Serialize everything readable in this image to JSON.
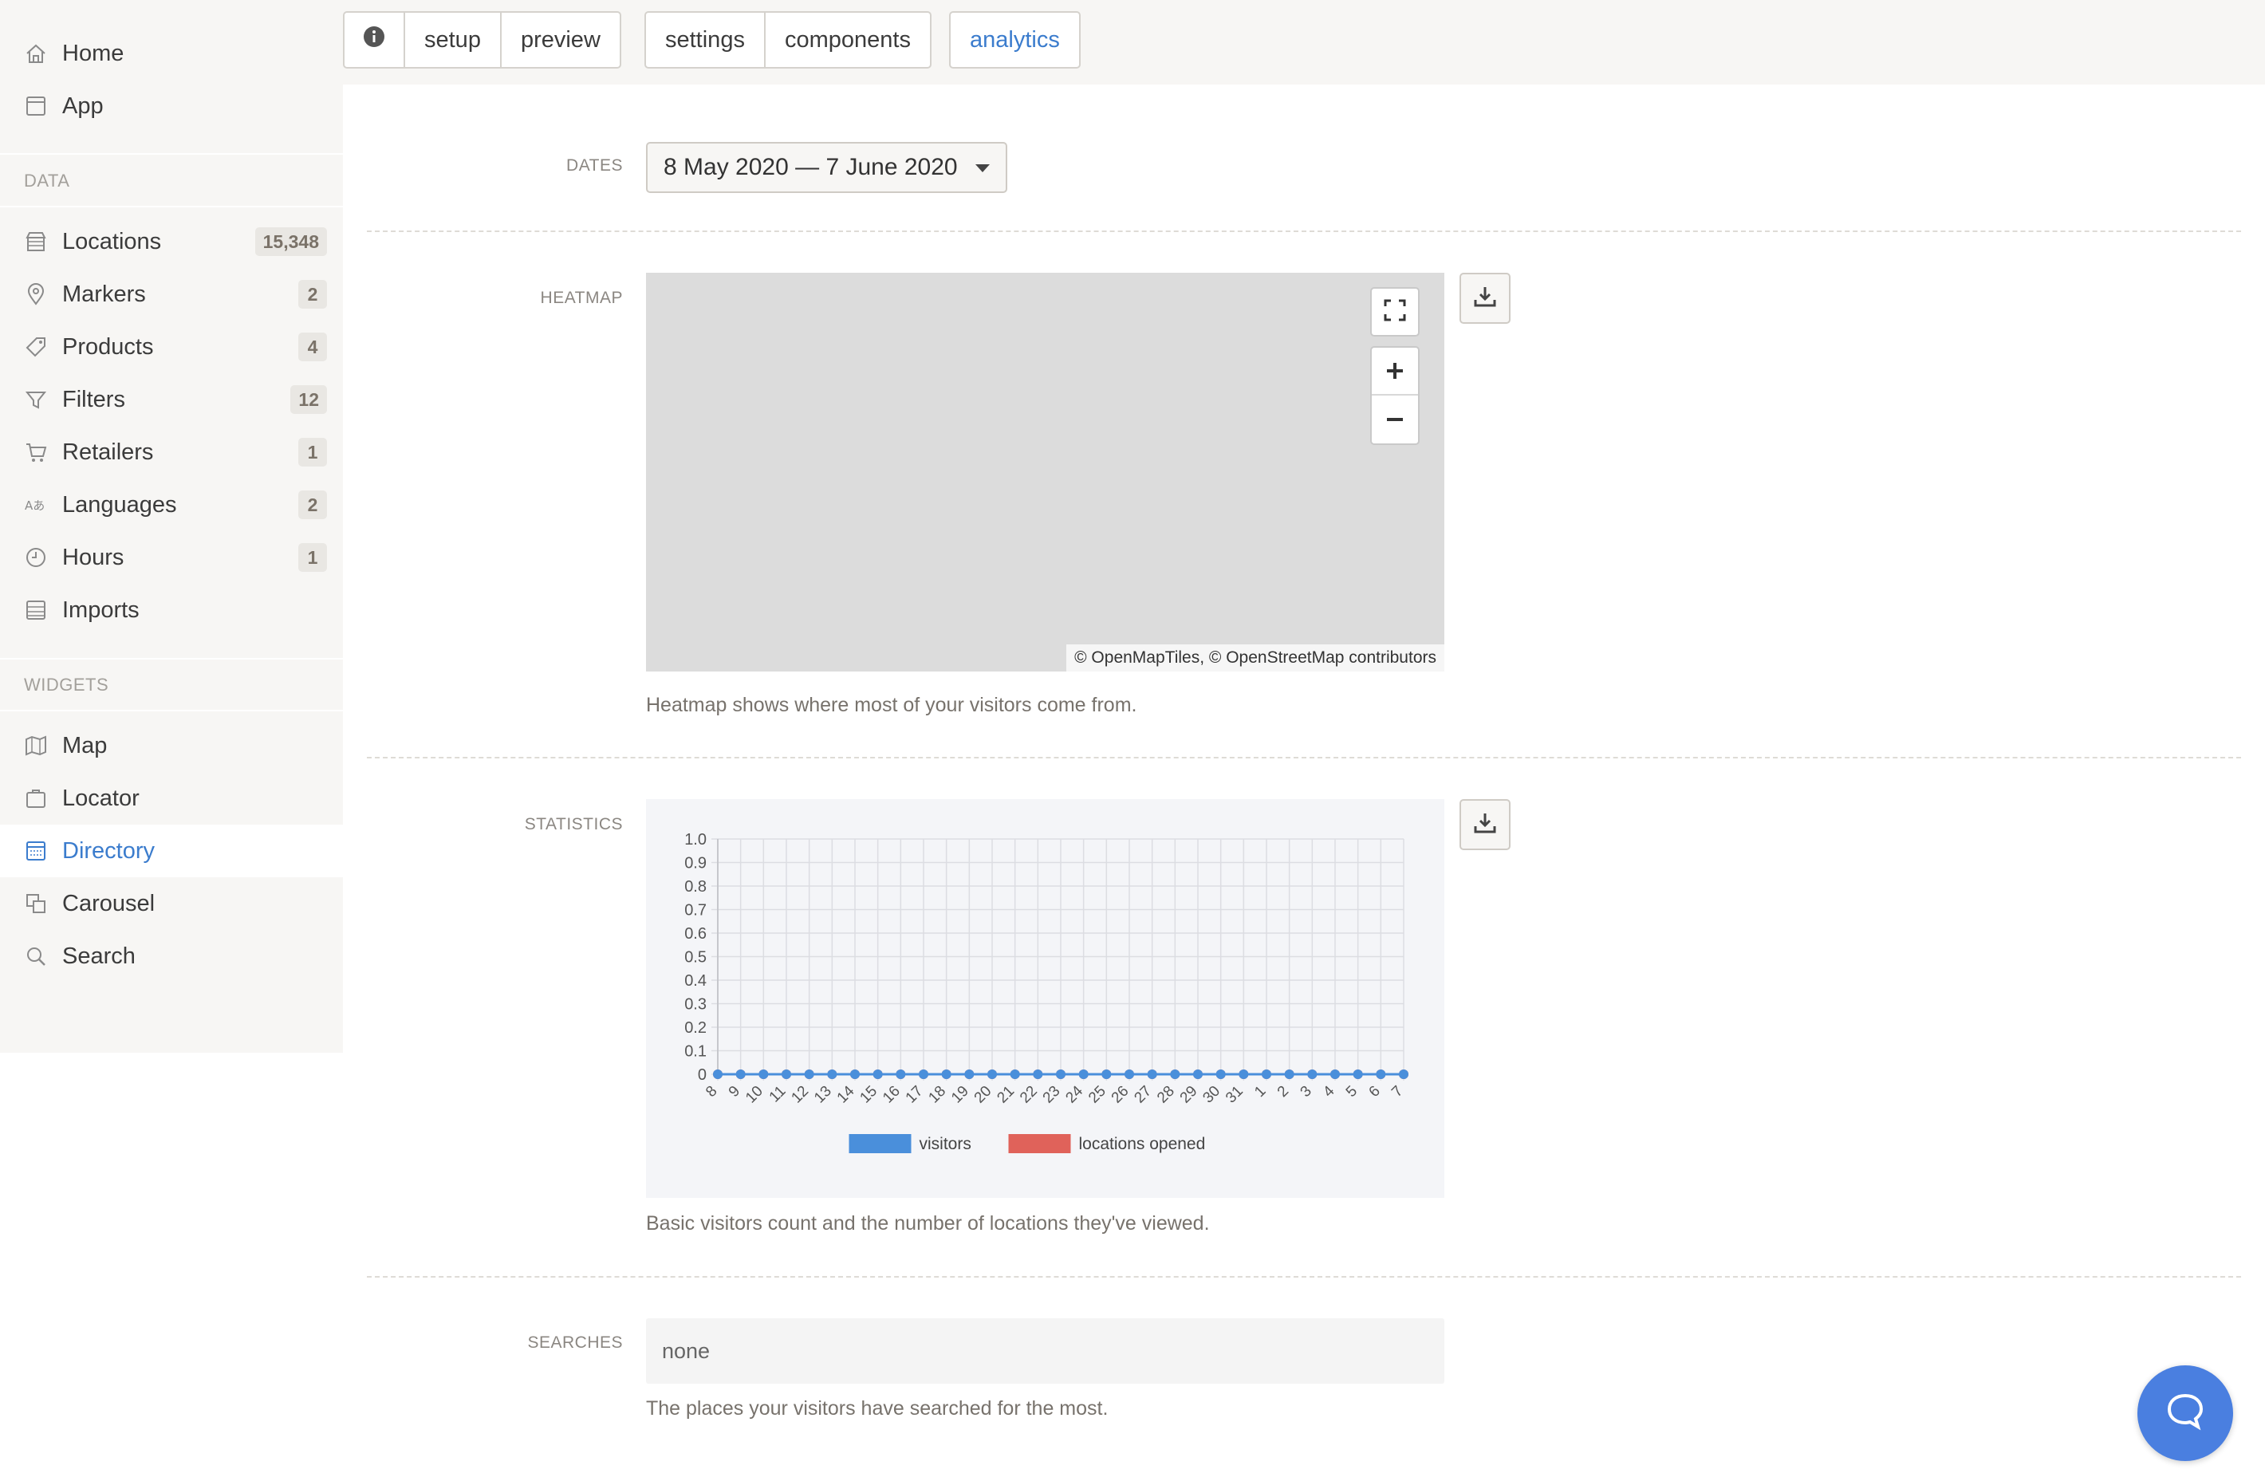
{
  "sidebar": {
    "top_items": [
      {
        "label": "Home",
        "icon": "home-icon"
      },
      {
        "label": "App",
        "icon": "app-icon"
      }
    ],
    "data_heading": "DATA",
    "data_items": [
      {
        "label": "Locations",
        "badge": "15,348",
        "icon": "store-icon"
      },
      {
        "label": "Markers",
        "badge": "2",
        "icon": "marker-icon"
      },
      {
        "label": "Products",
        "badge": "4",
        "icon": "tag-icon"
      },
      {
        "label": "Filters",
        "badge": "12",
        "icon": "filter-icon"
      },
      {
        "label": "Retailers",
        "badge": "1",
        "icon": "cart-icon"
      },
      {
        "label": "Languages",
        "badge": "2",
        "icon": "language-icon"
      },
      {
        "label": "Hours",
        "badge": "1",
        "icon": "clock-icon"
      },
      {
        "label": "Imports",
        "badge": "",
        "icon": "import-icon"
      }
    ],
    "widgets_heading": "WIDGETS",
    "widget_items": [
      {
        "label": "Map",
        "icon": "map-icon"
      },
      {
        "label": "Locator",
        "icon": "locator-icon"
      },
      {
        "label": "Directory",
        "icon": "directory-icon",
        "active": true
      },
      {
        "label": "Carousel",
        "icon": "carousel-icon"
      },
      {
        "label": "Search",
        "icon": "search-icon"
      }
    ]
  },
  "toolbar": {
    "group1": [
      "setup",
      "preview"
    ],
    "group2": [
      "settings",
      "components"
    ],
    "group3": [
      "analytics"
    ],
    "active_tab": "analytics"
  },
  "dates": {
    "label": "DATES",
    "value": "8 May 2020 — 7 June 2020"
  },
  "heatmap": {
    "label": "HEATMAP",
    "attribution": "© OpenMapTiles, © OpenStreetMap contributors",
    "help": "Heatmap shows where most of your visitors come from."
  },
  "statistics": {
    "label": "STATISTICS",
    "help": "Basic visitors count and the number of locations they've viewed."
  },
  "searches": {
    "label": "SEARCHES",
    "value": "none",
    "help": "The places your visitors have searched for the most."
  },
  "colors": {
    "accent": "#3b7ccd",
    "visitors": "#4a8fdb",
    "locations_opened": "#e0625a",
    "chat": "#4a7fe0"
  },
  "chart_data": {
    "type": "line",
    "x": [
      "8",
      "9",
      "10",
      "11",
      "12",
      "13",
      "14",
      "15",
      "16",
      "17",
      "18",
      "19",
      "20",
      "21",
      "22",
      "23",
      "24",
      "25",
      "26",
      "27",
      "28",
      "29",
      "30",
      "31",
      "1",
      "2",
      "3",
      "4",
      "5",
      "6",
      "7"
    ],
    "series": [
      {
        "name": "visitors",
        "values": [
          0,
          0,
          0,
          0,
          0,
          0,
          0,
          0,
          0,
          0,
          0,
          0,
          0,
          0,
          0,
          0,
          0,
          0,
          0,
          0,
          0,
          0,
          0,
          0,
          0,
          0,
          0,
          0,
          0,
          0,
          0
        ]
      },
      {
        "name": "locations opened",
        "values": [
          0,
          0,
          0,
          0,
          0,
          0,
          0,
          0,
          0,
          0,
          0,
          0,
          0,
          0,
          0,
          0,
          0,
          0,
          0,
          0,
          0,
          0,
          0,
          0,
          0,
          0,
          0,
          0,
          0,
          0,
          0
        ]
      }
    ],
    "y_ticks": [
      "1.0",
      "0.9",
      "0.8",
      "0.7",
      "0.6",
      "0.5",
      "0.4",
      "0.3",
      "0.2",
      "0.1",
      "0"
    ],
    "ylim": [
      0,
      1
    ],
    "grid": true,
    "legend": "bottom"
  }
}
